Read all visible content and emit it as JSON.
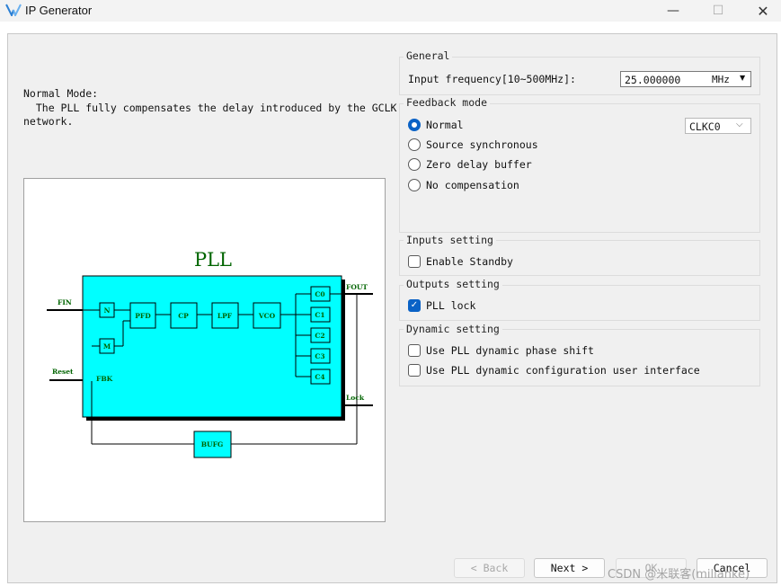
{
  "window": {
    "title": "IP Generator",
    "icon": "app-logo-icon",
    "controls": {
      "minimize": "—",
      "maximize": "☐",
      "close": "✕"
    }
  },
  "description": {
    "line1": "Normal Mode:",
    "line2": "  The PLL fully compensates the delay introduced by the GCLK",
    "line3": "network."
  },
  "diagram": {
    "title": "PLL",
    "inputs": {
      "fin": "FIN",
      "reset": "Reset",
      "fbk": "FBK"
    },
    "outputs": {
      "fout": "FOUT",
      "lock": "Lock"
    },
    "blocks": {
      "n": "N",
      "m": "M",
      "pfd": "PFD",
      "cp": "CP",
      "lpf": "LPF",
      "vco": "VCO",
      "bufg": "BUFG"
    },
    "counters": [
      "C0",
      "C1",
      "C2",
      "C3",
      "C4"
    ],
    "colors": {
      "fill": "#00ffff",
      "shadow": "#000000",
      "text": "#006400"
    }
  },
  "general": {
    "title": "General",
    "freq_label": "Input frequency[10~500MHz]:",
    "freq_value": "25.000000",
    "freq_unit": "MHz"
  },
  "feedback": {
    "title": "Feedback mode",
    "options": [
      {
        "label": "Normal",
        "checked": true
      },
      {
        "label": "Source synchronous",
        "checked": false
      },
      {
        "label": "Zero delay buffer",
        "checked": false
      },
      {
        "label": "No compensation",
        "checked": false
      }
    ],
    "clock_select": "CLKC0"
  },
  "inputs_setting": {
    "title": "Inputs setting",
    "enable_standby": {
      "label": "Enable Standby",
      "checked": false
    }
  },
  "outputs_setting": {
    "title": "Outputs setting",
    "pll_lock": {
      "label": "PLL lock",
      "checked": true
    }
  },
  "dynamic_setting": {
    "title": "Dynamic setting",
    "phase_shift": {
      "label": "Use PLL dynamic phase shift",
      "checked": false
    },
    "config_ui": {
      "label": "Use PLL dynamic configuration user interface",
      "checked": false
    }
  },
  "buttons": {
    "back": "< Back",
    "next": "Next >",
    "ok": "OK",
    "cancel": "Cancel"
  },
  "watermark": "CSDN @米联客(milianke)",
  "colors": {
    "accent": "#0a62c6",
    "panel": "#f0f0f0"
  }
}
